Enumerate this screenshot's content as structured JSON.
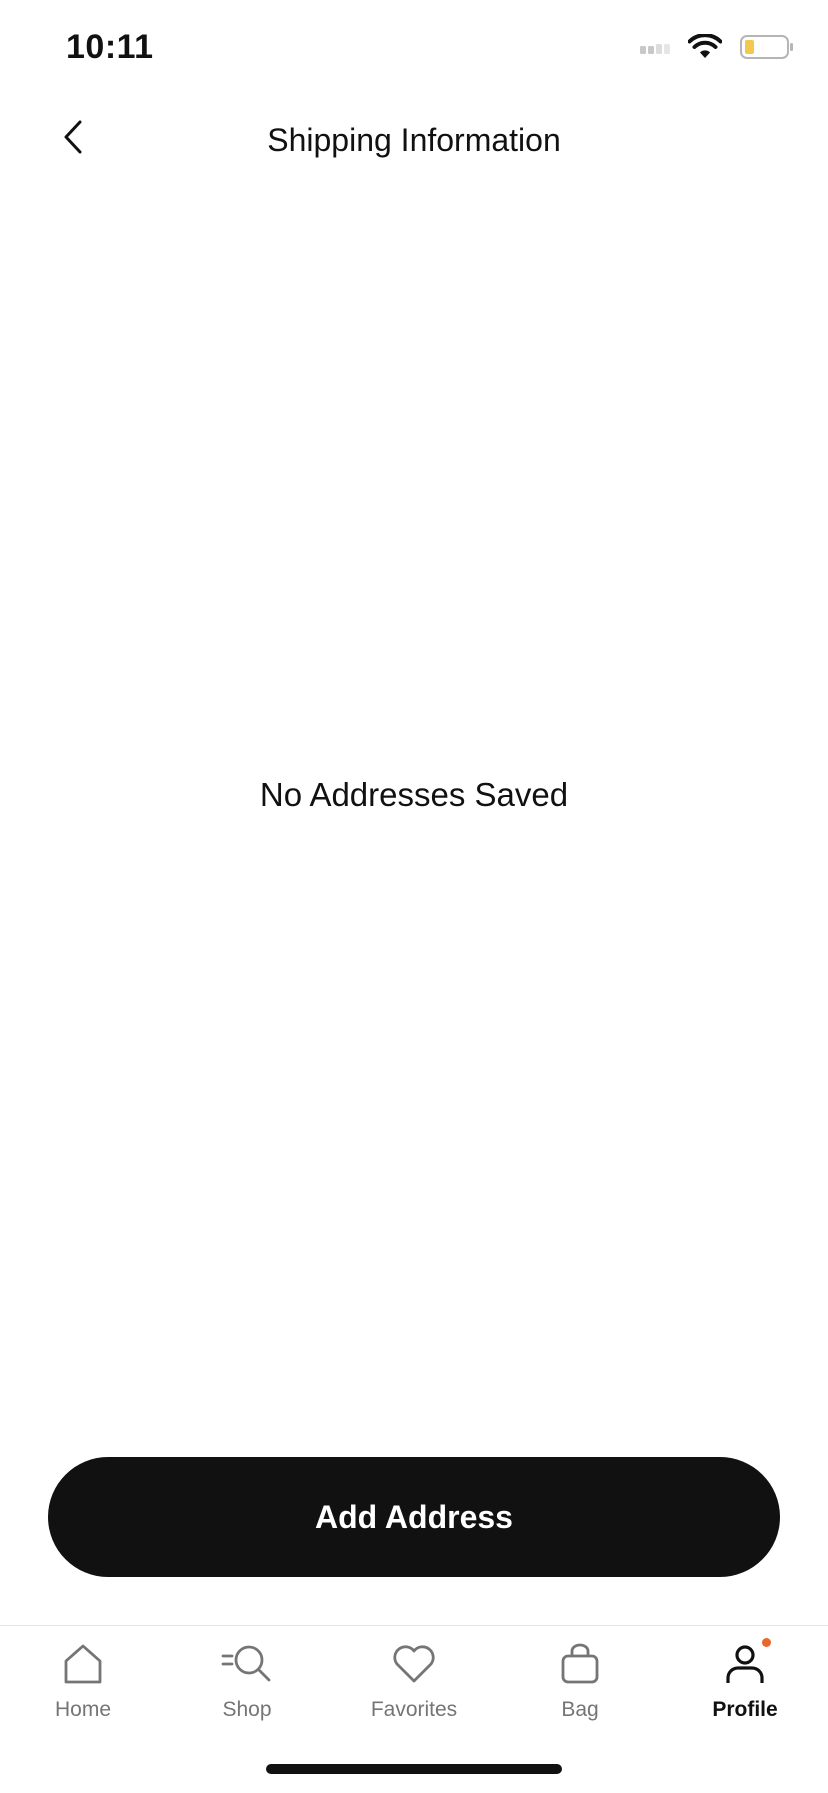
{
  "status_bar": {
    "time": "10:11"
  },
  "header": {
    "title": "Shipping Information"
  },
  "main": {
    "empty_message": "No Addresses Saved"
  },
  "actions": {
    "add_address_label": "Add Address"
  },
  "tab_bar": {
    "items": [
      {
        "label": "Home",
        "icon": "home-icon"
      },
      {
        "label": "Shop",
        "icon": "search-icon"
      },
      {
        "label": "Favorites",
        "icon": "heart-icon"
      },
      {
        "label": "Bag",
        "icon": "bag-icon"
      },
      {
        "label": "Profile",
        "icon": "profile-icon",
        "active": true,
        "notification": true
      }
    ]
  },
  "colors": {
    "primary": "#111111",
    "inactive": "#757575",
    "notification": "#e8672b",
    "battery": "#f2c94c"
  }
}
